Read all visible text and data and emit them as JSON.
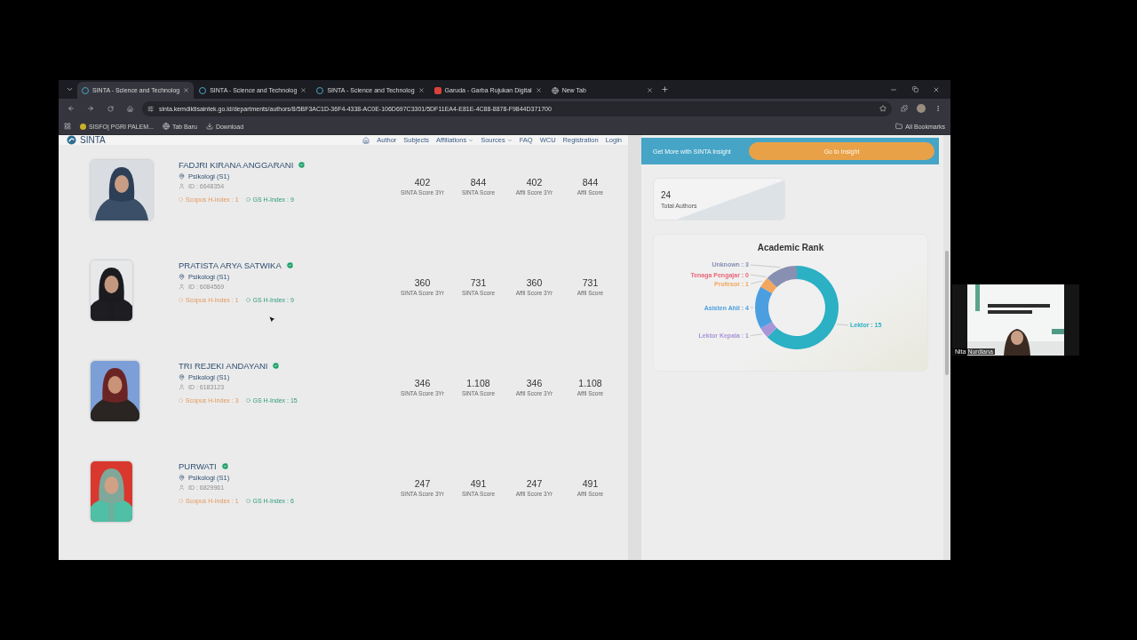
{
  "browser": {
    "tabs": [
      {
        "title": "SINTA - Science and Technolog",
        "kind": "sinta",
        "selected": true
      },
      {
        "title": "SINTA - Science and Technolog",
        "kind": "sinta",
        "selected": false
      },
      {
        "title": "SINTA - Science and Technolog",
        "kind": "sinta",
        "selected": false
      },
      {
        "title": "Garuda - Garba Rujukan Digital",
        "kind": "garuda",
        "selected": false
      },
      {
        "title": "New Tab",
        "kind": "chrome",
        "selected": false
      }
    ],
    "url": "sinta.kemdiktisaintek.go.id/departments/authors/8/5BF3AC1D-36F4-4338-AC0E-106D697C3301/5DF11EA4-E81E-4C88-8878-F9844D371700",
    "bookmarks": [
      {
        "label": "SISFO| PGRI PALEM...",
        "kind": "site"
      },
      {
        "label": "Tab Baru",
        "kind": "globe"
      },
      {
        "label": "Download",
        "kind": "download"
      }
    ],
    "all_bookmarks": "All Bookmarks"
  },
  "site": {
    "logo": "SINTA",
    "nav": [
      {
        "label": "Author",
        "dropdown": false
      },
      {
        "label": "Subjects",
        "dropdown": false
      },
      {
        "label": "Affiliations",
        "dropdown": true
      },
      {
        "label": "Sources",
        "dropdown": true
      },
      {
        "label": "FAQ",
        "dropdown": false
      },
      {
        "label": "WCU",
        "dropdown": false
      },
      {
        "label": "Registration",
        "dropdown": false
      },
      {
        "label": "Login",
        "dropdown": false
      }
    ]
  },
  "authors": [
    {
      "name": "FADJRI KIRANA ANGGARANI",
      "verified": true,
      "department": "Psikologi (S1)",
      "id": "ID : 6648354",
      "scopus": "Scopus H-Index : 1",
      "gs": "GS H-Index : 9",
      "scores": [
        {
          "value": "402",
          "label": "SINTA Score 3Yr"
        },
        {
          "value": "844",
          "label": "SINTA Score"
        },
        {
          "value": "402",
          "label": "Affil Score 3Yr"
        },
        {
          "value": "844",
          "label": "Affil Score"
        }
      ]
    },
    {
      "name": "PRATISTA ARYA SATWIKA",
      "verified": true,
      "department": "Psikologi (S1)",
      "id": "ID : 6084569",
      "scopus": "Scopus H-Index : 1",
      "gs": "GS H-Index : 9",
      "scores": [
        {
          "value": "360",
          "label": "SINTA Score 3Yr"
        },
        {
          "value": "731",
          "label": "SINTA Score"
        },
        {
          "value": "360",
          "label": "Affil Score 3Yr"
        },
        {
          "value": "731",
          "label": "Affil Score"
        }
      ]
    },
    {
      "name": "TRI REJEKI ANDAYANI",
      "verified": true,
      "department": "Psikologi (S1)",
      "id": "ID : 6183123",
      "scopus": "Scopus H-Index : 3",
      "gs": "GS H-Index : 15",
      "scores": [
        {
          "value": "346",
          "label": "SINTA Score 3Yr"
        },
        {
          "value": "1.108",
          "label": "SINTA Score"
        },
        {
          "value": "346",
          "label": "Affil Score 3Yr"
        },
        {
          "value": "1.108",
          "label": "Affil Score"
        }
      ]
    },
    {
      "name": "PURWATI",
      "verified": true,
      "department": "Psikologi (S1)",
      "id": "ID : 6829961",
      "scopus": "Scopus H-Index : 1",
      "gs": "GS H-Index : 6",
      "scores": [
        {
          "value": "247",
          "label": "SINTA Score 3Yr"
        },
        {
          "value": "491",
          "label": "SINTA Score"
        },
        {
          "value": "247",
          "label": "Affil Score 3Yr"
        },
        {
          "value": "491",
          "label": "Affil Score"
        }
      ]
    }
  ],
  "insight": {
    "text": "Get More with SINTA Insight",
    "button": "Go to Insight"
  },
  "total": {
    "value": "24",
    "label": "Total Authors"
  },
  "rank": {
    "title": "Academic Rank",
    "slice_colors": [
      {
        "color": "#2bb0c4"
      },
      {
        "color": "#a895d8"
      },
      {
        "color": "#4b9fe0"
      },
      {
        "color": "#f3a75c"
      },
      {
        "color": "#e8677a"
      },
      {
        "color": "#8890b2"
      }
    ],
    "chart_data": {
      "type": "donut",
      "values": [
        15,
        1,
        4,
        1,
        0,
        3
      ],
      "value_labels": [
        "Lektor : 15",
        "Lektor Kepala : 1",
        "Asisten Ahli : 4",
        "Profesor : 1",
        "Tenaga Pengajar : 0",
        "Unknown : 3"
      ]
    }
  },
  "participant": {
    "name": "Nita Nurdiana"
  }
}
